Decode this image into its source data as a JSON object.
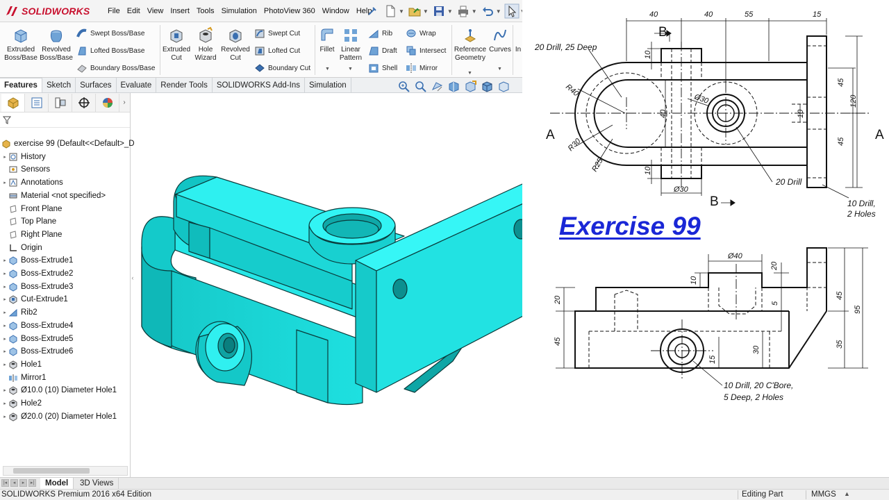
{
  "app": {
    "brand": "SOLIDWORKS",
    "brand_color": "#c8102e"
  },
  "menu": [
    "File",
    "Edit",
    "View",
    "Insert",
    "Tools",
    "Simulation",
    "PhotoView 360",
    "Window",
    "Help"
  ],
  "ribbon": {
    "extruded_boss": "Extruded Boss/Base",
    "revolved_boss": "Revolved Boss/Base",
    "swept_boss": "Swept Boss/Base",
    "lofted_boss": "Lofted Boss/Base",
    "boundary_boss": "Boundary Boss/Base",
    "extruded_cut": "Extruded Cut",
    "hole_wizard": "Hole Wizard",
    "revolved_cut": "Revolved Cut",
    "swept_cut": "Swept Cut",
    "lofted_cut": "Lofted Cut",
    "boundary_cut": "Boundary Cut",
    "fillet": "Fillet",
    "linear_pattern": "Linear Pattern",
    "rib": "Rib",
    "draft": "Draft",
    "shell": "Shell",
    "wrap": "Wrap",
    "intersect": "Intersect",
    "mirror": "Mirror",
    "reference_geometry": "Reference Geometry",
    "curves": "Curves",
    "instant3d": "In"
  },
  "command_tabs": [
    "Features",
    "Sketch",
    "Surfaces",
    "Evaluate",
    "Render Tools",
    "SOLIDWORKS Add-Ins",
    "Simulation"
  ],
  "active_command_tab": "Features",
  "tree": {
    "root": "exercise 99  (Default<<Default>_D",
    "items": [
      {
        "label": "History",
        "icon": "history-icon",
        "expandable": true
      },
      {
        "label": "Sensors",
        "icon": "sensors-icon",
        "expandable": false
      },
      {
        "label": "Annotations",
        "icon": "annotations-icon",
        "expandable": true
      },
      {
        "label": "Material <not specified>",
        "icon": "material-icon",
        "expandable": false
      },
      {
        "label": "Front Plane",
        "icon": "plane-icon",
        "expandable": false
      },
      {
        "label": "Top Plane",
        "icon": "plane-icon",
        "expandable": false
      },
      {
        "label": "Right Plane",
        "icon": "plane-icon",
        "expandable": false
      },
      {
        "label": "Origin",
        "icon": "origin-icon",
        "expandable": false
      },
      {
        "label": "Boss-Extrude1",
        "icon": "extrude-icon",
        "expandable": true
      },
      {
        "label": "Boss-Extrude2",
        "icon": "extrude-icon",
        "expandable": true
      },
      {
        "label": "Boss-Extrude3",
        "icon": "extrude-icon",
        "expandable": true
      },
      {
        "label": "Cut-Extrude1",
        "icon": "cut-icon",
        "expandable": true
      },
      {
        "label": "Rib2",
        "icon": "rib-icon",
        "expandable": true
      },
      {
        "label": "Boss-Extrude4",
        "icon": "extrude-icon",
        "expandable": true
      },
      {
        "label": "Boss-Extrude5",
        "icon": "extrude-icon",
        "expandable": true
      },
      {
        "label": "Boss-Extrude6",
        "icon": "extrude-icon",
        "expandable": true
      },
      {
        "label": "Hole1",
        "icon": "hole-icon",
        "expandable": true
      },
      {
        "label": "Mirror1",
        "icon": "mirror-icon",
        "expandable": false
      },
      {
        "label": "Ø10.0 (10) Diameter Hole1",
        "icon": "hole-icon",
        "expandable": true
      },
      {
        "label": "Hole2",
        "icon": "hole-icon",
        "expandable": true
      },
      {
        "label": "Ø20.0 (20) Diameter Hole1",
        "icon": "hole-icon",
        "expandable": true
      }
    ]
  },
  "bottom_tabs": [
    "Model",
    "3D Views"
  ],
  "status": {
    "edition": "SOLIDWORKS Premium 2016 x64 Edition",
    "mode": "Editing Part",
    "units": "MMGS"
  },
  "model_color": "#1ee0e0",
  "drawing": {
    "title": "Exercise 99",
    "title_color": "#1a27d6",
    "top_view": {
      "dims_top": [
        "40",
        "40",
        "55",
        "15"
      ],
      "section_b": "B",
      "section_a": "A",
      "note_drill_top": "20 Drill, 25 Deep",
      "r40": "R40",
      "r30": "R30",
      "r25": "R25",
      "d30_circle": "Ø30",
      "d30_bottom": "Ø30",
      "v10_top": "10",
      "v40": "40",
      "v10_bottom": "10",
      "v10_right": "10",
      "v45_a": "45",
      "v45_b": "45",
      "v120": "120",
      "note_20drill": "20 Drill",
      "note_10drill_1": "10 Drill,",
      "note_10drill_2": "2 Holes"
    },
    "front_view": {
      "d40": "Ø40",
      "v20_top": "20",
      "v10": "10",
      "v20_left": "20",
      "v5": "5",
      "v45_left": "45",
      "v30": "30",
      "v15": "15",
      "v45_right": "45",
      "v95": "95",
      "v35": "35",
      "note_1": "10 Drill, 20 C'Bore,",
      "note_2": "5 Deep, 2 Holes"
    }
  }
}
